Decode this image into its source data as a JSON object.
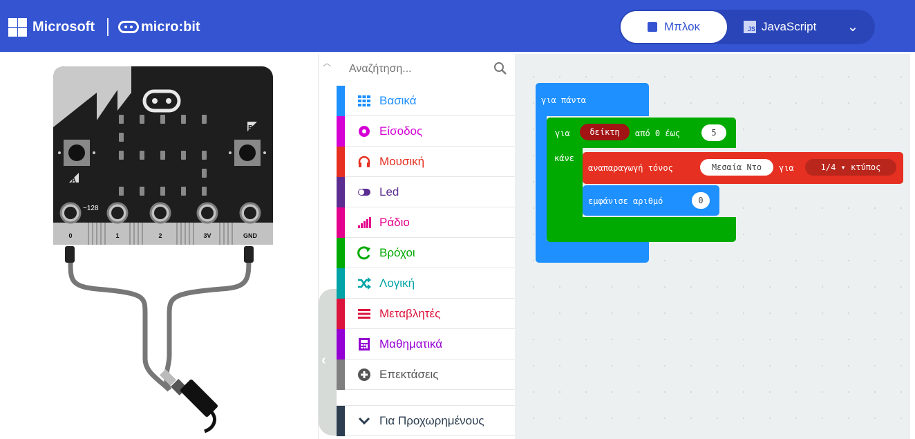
{
  "header": {
    "brand": "Microsoft",
    "product": "micro:bit",
    "tab_blocks": "Μπλοκ",
    "tab_js": "JavaScript",
    "js_badge": "JS",
    "colors": {
      "header_bg": "#3454d1"
    }
  },
  "simulator": {
    "pins": [
      "0",
      "1",
      "2",
      "3V",
      "GND"
    ],
    "pin_readout": "~128",
    "button_a": "A",
    "button_b": "B"
  },
  "toolbox": {
    "search_placeholder": "Αναζήτηση...",
    "categories": [
      {
        "label": "Βασικά",
        "color": "#1e90ff",
        "icon": "grid-icon"
      },
      {
        "label": "Είσοδος",
        "color": "#d400d4",
        "icon": "input-circle-icon"
      },
      {
        "label": "Μουσική",
        "color": "#e63022",
        "icon": "headphones-icon"
      },
      {
        "label": "Led",
        "color": "#5c2d91",
        "icon": "toggle-icon"
      },
      {
        "label": "Ράδιο",
        "color": "#e3008c",
        "icon": "signal-bars-icon"
      },
      {
        "label": "Βρόχοι",
        "color": "#00aa00",
        "icon": "loop-arrow-icon"
      },
      {
        "label": "Λογική",
        "color": "#00a4a6",
        "icon": "shuffle-icon"
      },
      {
        "label": "Μεταβλητές",
        "color": "#dc143c",
        "icon": "lines-icon"
      },
      {
        "label": "Μαθηματικά",
        "color": "#9400d3",
        "icon": "calculator-icon"
      },
      {
        "label": "Επεκτάσεις",
        "color": "#7f7f7f",
        "icon": "plus-circle-icon"
      },
      {
        "label": "Για Προχωρημένους",
        "color": "#2c3e50",
        "icon": "chevron-down-icon"
      }
    ]
  },
  "workspace": {
    "forever_label": "για πάντα",
    "for_label": "για",
    "index_var": "δείκτη",
    "range_label": "από 0 έως",
    "range_end": "5",
    "do_label": "κάνε",
    "play_tone_label": "αναπαραγωγή τόνος",
    "note_value": "Μεσαία Ντο",
    "for_duration_label": "για",
    "beat_value": "1/4 ▾ κτύπος",
    "show_number_label": "εμφάνισε αριθμό",
    "number_value": "0",
    "colors": {
      "forever": "#1e90ff",
      "loop": "#00aa00",
      "music": "#e63022",
      "basic": "#1e90ff"
    }
  }
}
